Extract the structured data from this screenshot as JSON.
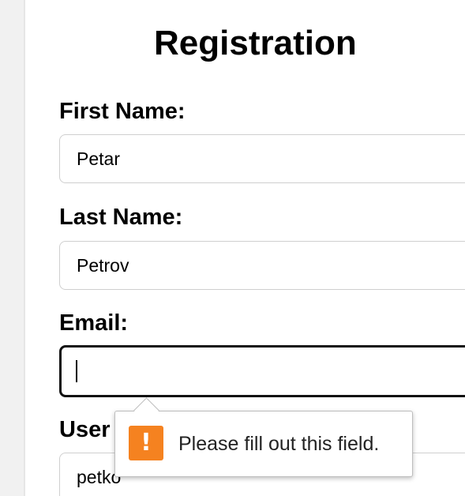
{
  "form": {
    "title": "Registration",
    "first_name": {
      "label": "First Name:",
      "value": "Petar"
    },
    "last_name": {
      "label": "Last Name:",
      "value": "Petrov"
    },
    "email": {
      "label": "Email:",
      "value": ""
    },
    "username": {
      "label": "User",
      "value": "petko"
    }
  },
  "validation_tooltip": {
    "icon": "warning-icon",
    "icon_glyph": "!",
    "message": "Please fill out this field.",
    "icon_color": "#f58220"
  }
}
